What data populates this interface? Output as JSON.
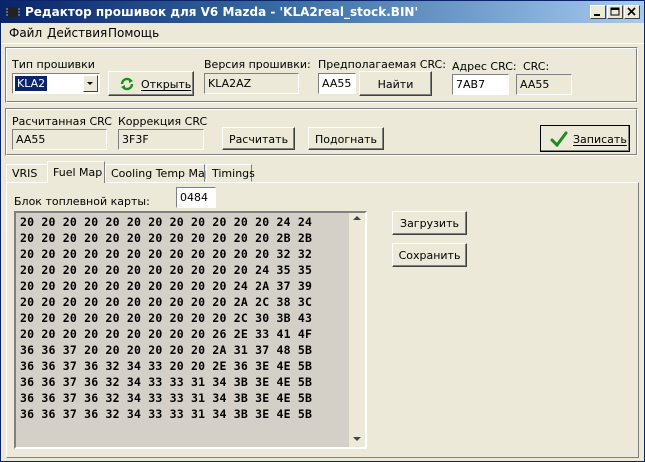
{
  "window": {
    "title": "Редактор прошивок для V6 Mazda - 'KLA2real_stock.BIN'"
  },
  "menu": [
    "Файл",
    "Действия",
    "Помощь"
  ],
  "firmware_type": {
    "label": "Тип прошивки",
    "value": "KLA2"
  },
  "open_button": "Открыть",
  "firmware_version": {
    "label": "Версия прошивки:",
    "value": "KLA2AZ"
  },
  "expected_crc": {
    "label": "Предполагаемая CRC:",
    "value": "AA55"
  },
  "find_button": "Найти",
  "crc_address": {
    "label": "Адрес CRC:",
    "value": "7AB7"
  },
  "crc": {
    "label": "CRC:",
    "value": "AA55"
  },
  "computed_crc": {
    "label": "Расчитанная CRC",
    "value": "AA55"
  },
  "crc_correction": {
    "label": "Коррекция CRC",
    "value": "3F3F"
  },
  "calculate_button": "Расчитать",
  "fit_button": "Подогнать",
  "write_button": "Записать",
  "tabs": [
    "VRIS",
    "Fuel Map",
    "Cooling Temp Map",
    "Timings"
  ],
  "fuel_map": {
    "block_label": "Блок топлевной карты:",
    "block_value": "0484",
    "rows": [
      "20 20 20 20 20 20 20 20 20 20 20 20 24 24",
      "20 20 20 20 20 20 20 20 20 20 20 20 2B 2B",
      "20 20 20 20 20 20 20 20 20 20 20 20 32 32",
      "20 20 20 20 20 20 20 20 20 20 20 24 35 35",
      "20 20 20 20 20 20 20 20 20 20 24 2A 37 39",
      "20 20 20 20 20 20 20 20 20 20 2A 2C 38 3C",
      "20 20 20 20 20 20 20 20 20 20 2C 30 3B 43",
      "20 20 20 20 20 20 20 20 20 26 2E 33 41 4F",
      "36 36 37 20 20 20 20 20 20 2A 31 37 48 5B",
      "36 36 37 36 32 34 33 20 20 2E 36 3E 4E 5B",
      "36 36 37 36 32 34 33 33 31 34 3B 3E 4E 5B",
      "36 36 37 36 32 34 33 33 31 34 3B 3E 4E 5B",
      "36 36 37 36 32 34 33 33 31 34 3B 3E 4E 5B"
    ],
    "load_button": "Загрузить",
    "save_button": "Сохранить"
  }
}
